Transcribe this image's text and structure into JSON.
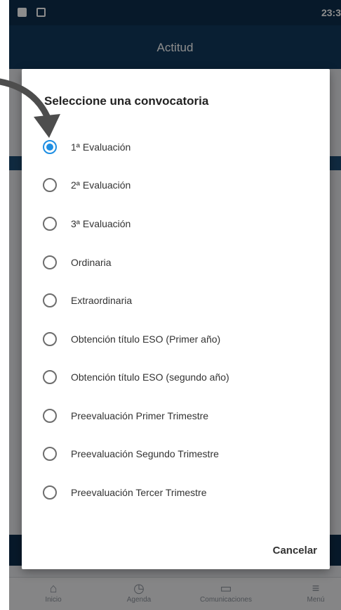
{
  "status_bar": {
    "time": "23:3"
  },
  "app_bar": {
    "title": "Actitud"
  },
  "bottom_nav": [
    {
      "label": "Inicio",
      "glyph": "⌂"
    },
    {
      "label": "Agenda",
      "glyph": "◷"
    },
    {
      "label": "Comunicaciones",
      "glyph": "▭"
    },
    {
      "label": "Menú",
      "glyph": "≡"
    }
  ],
  "dialog": {
    "title": "Seleccione una convocatoria",
    "options": [
      {
        "label": "1ª Evaluación",
        "selected": true
      },
      {
        "label": "2ª Evaluación",
        "selected": false
      },
      {
        "label": "3ª Evaluación",
        "selected": false
      },
      {
        "label": "Ordinaria",
        "selected": false
      },
      {
        "label": "Extraordinaria",
        "selected": false
      },
      {
        "label": "Obtención título ESO (Primer año)",
        "selected": false
      },
      {
        "label": "Obtención título ESO (segundo año)",
        "selected": false
      },
      {
        "label": "Preevaluación Primer Trimestre",
        "selected": false
      },
      {
        "label": "Preevaluación Segundo Trimestre",
        "selected": false
      },
      {
        "label": "Preevaluación Tercer Trimestre",
        "selected": false
      }
    ],
    "cancel_label": "Cancelar"
  },
  "colors": {
    "accent": "#1f8fe3",
    "header": "#123a5e",
    "arrow": "#4d4d4d"
  }
}
